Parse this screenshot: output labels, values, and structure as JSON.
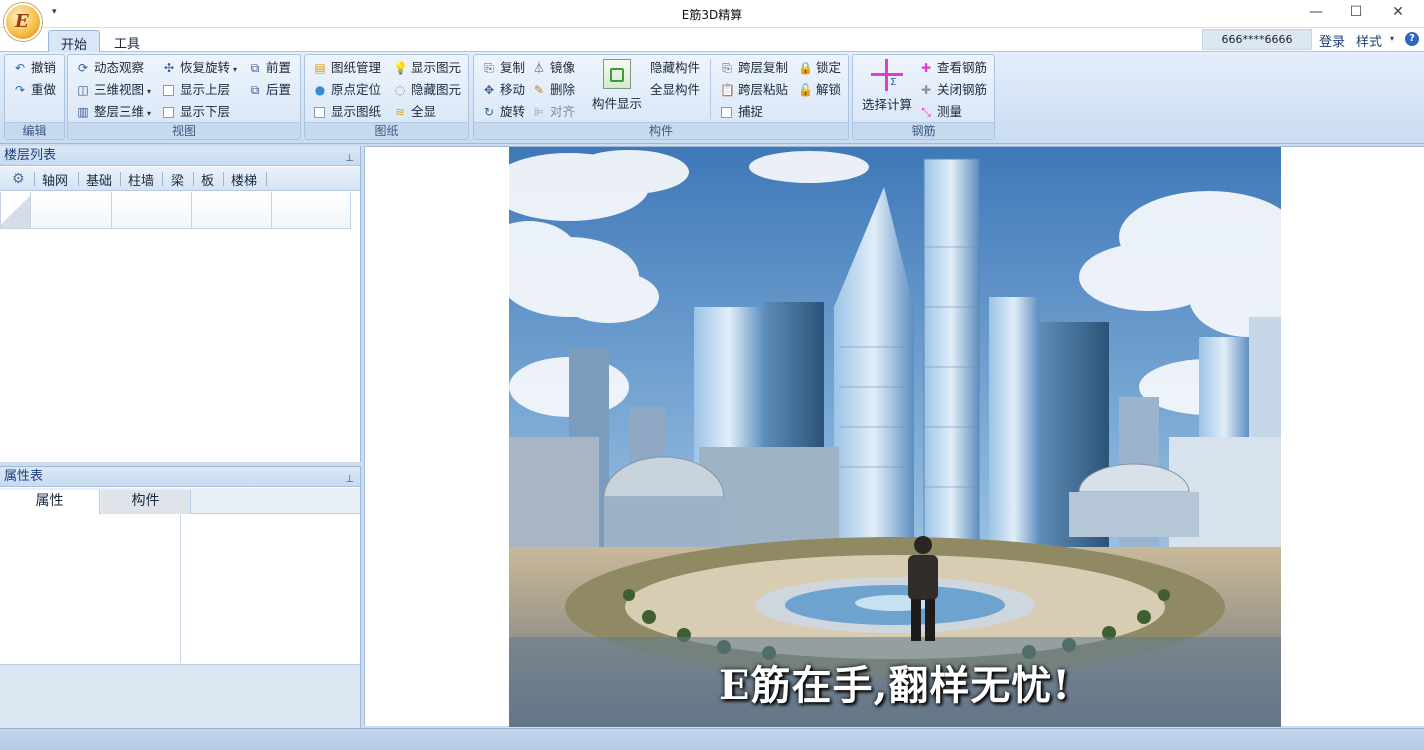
{
  "window": {
    "title": "E筋3D精算",
    "min": "—",
    "max": "☐",
    "close": "✕"
  },
  "tabs": {
    "home": "开始",
    "tools": "工具"
  },
  "account": {
    "user": "666****6666",
    "login": "登录",
    "style": "样式"
  },
  "ribbon": {
    "edit": {
      "label": "编辑",
      "undo": "撤销",
      "redo": "重做"
    },
    "view": {
      "label": "视图",
      "orbit": "动态观察",
      "restore_rotate": "恢复旋转",
      "bring_front": "前置",
      "view_3d": "三维视图",
      "show_upper": "显示上层",
      "send_back": "后置",
      "whole_3d": "整层三维",
      "show_lower": "显示下层"
    },
    "drawing": {
      "label": "图纸",
      "manage": "图纸管理",
      "show_element": "显示图元",
      "origin": "原点定位",
      "hide_element": "隐藏图元",
      "show_drawing": "显示图纸",
      "show_all": "全显"
    },
    "component": {
      "label": "构件",
      "copy": "复制",
      "mirror": "镜像",
      "move": "移动",
      "delete": "删除",
      "rotate": "旋转",
      "align": "对齐",
      "display": "构件显示",
      "hide": "隐藏构件",
      "show_all": "全显构件",
      "cross_copy": "跨层复制",
      "lock": "锁定",
      "cross_paste": "跨层粘贴",
      "unlock": "解锁",
      "snap": "捕捉"
    },
    "rebar": {
      "label": "钢筋",
      "select_calc": "选择计算",
      "view_rebar": "查看钢筋",
      "close_rebar": "关闭钢筋",
      "measure": "测量"
    }
  },
  "floor_panel": {
    "title": "楼层列表",
    "tabs": [
      "轴网",
      "基础",
      "柱墙",
      "梁",
      "板",
      "楼梯"
    ]
  },
  "prop_panel": {
    "title": "属性表",
    "tab_attr": "属性",
    "tab_comp": "构件"
  },
  "splash": {
    "slogan": "E筋在手,翻样无忧!"
  },
  "colors": {
    "ribbon": "#dbe7f6",
    "accent": "#1d3f78",
    "logo": "#f6c04a"
  }
}
